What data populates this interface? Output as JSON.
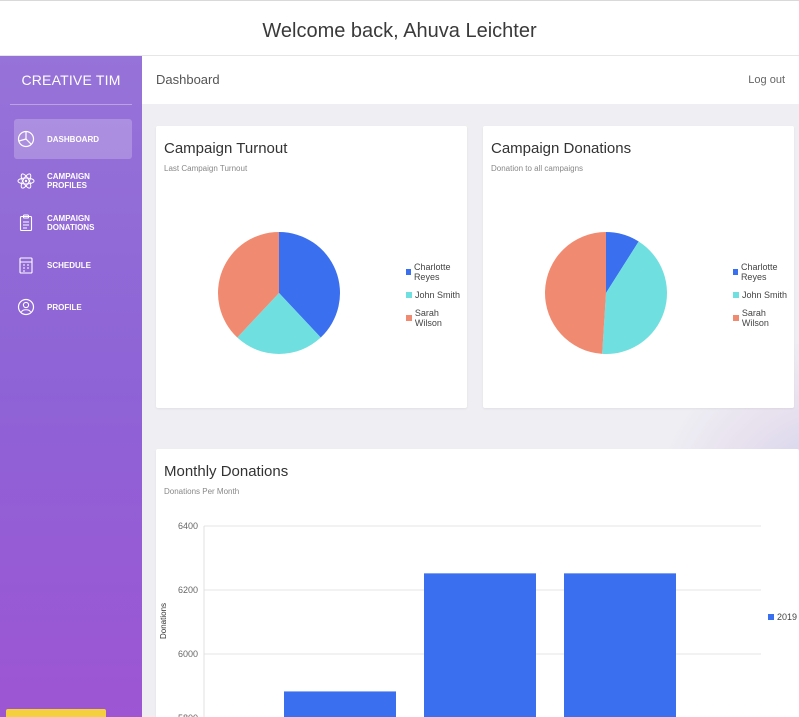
{
  "header": {
    "welcome": "Welcome back, Ahuva Leichter"
  },
  "sidebar": {
    "brand": "CREATIVE TIM",
    "items": [
      {
        "label": "DASHBOARD",
        "icon": "pie-chart-icon",
        "active": true
      },
      {
        "label": "CAMPAIGN PROFILES",
        "icon": "atom-icon",
        "active": false
      },
      {
        "label": "CAMPAIGN DONATIONS",
        "icon": "clipboard-icon",
        "active": false
      },
      {
        "label": "SCHEDULE",
        "icon": "calendar-icon",
        "active": false
      },
      {
        "label": "PROFILE",
        "icon": "user-icon",
        "active": false
      }
    ]
  },
  "topbar": {
    "title": "Dashboard",
    "logout": "Log out"
  },
  "colors": {
    "blue": "#3a6ff0",
    "cyan": "#70dfe0",
    "salmon": "#f08a70"
  },
  "cards": {
    "turnout": {
      "title": "Campaign Turnout",
      "subtitle": "Last Campaign Turnout"
    },
    "donations": {
      "title": "Campaign Donations",
      "subtitle": "Donation to all campaigns"
    },
    "monthly": {
      "title": "Monthly Donations",
      "subtitle": "Donations Per Month"
    }
  },
  "chart_data": [
    {
      "type": "pie",
      "labels": [
        "Charlotte Reyes",
        "John Smith",
        "Sarah Wilson"
      ],
      "values": [
        38,
        24,
        38
      ]
    },
    {
      "type": "pie",
      "labels": [
        "Charlotte Reyes",
        "John Smith",
        "Sarah Wilson"
      ],
      "values": [
        9,
        42,
        49
      ]
    },
    {
      "type": "bar",
      "series": [
        {
          "name": "2019",
          "values": [
            5883,
            6252,
            6252
          ]
        }
      ],
      "ylabel": "Donations",
      "ylim": [
        5800,
        6400
      ],
      "yticks": [
        "6400",
        "6200",
        "6000",
        "5800"
      ]
    }
  ]
}
